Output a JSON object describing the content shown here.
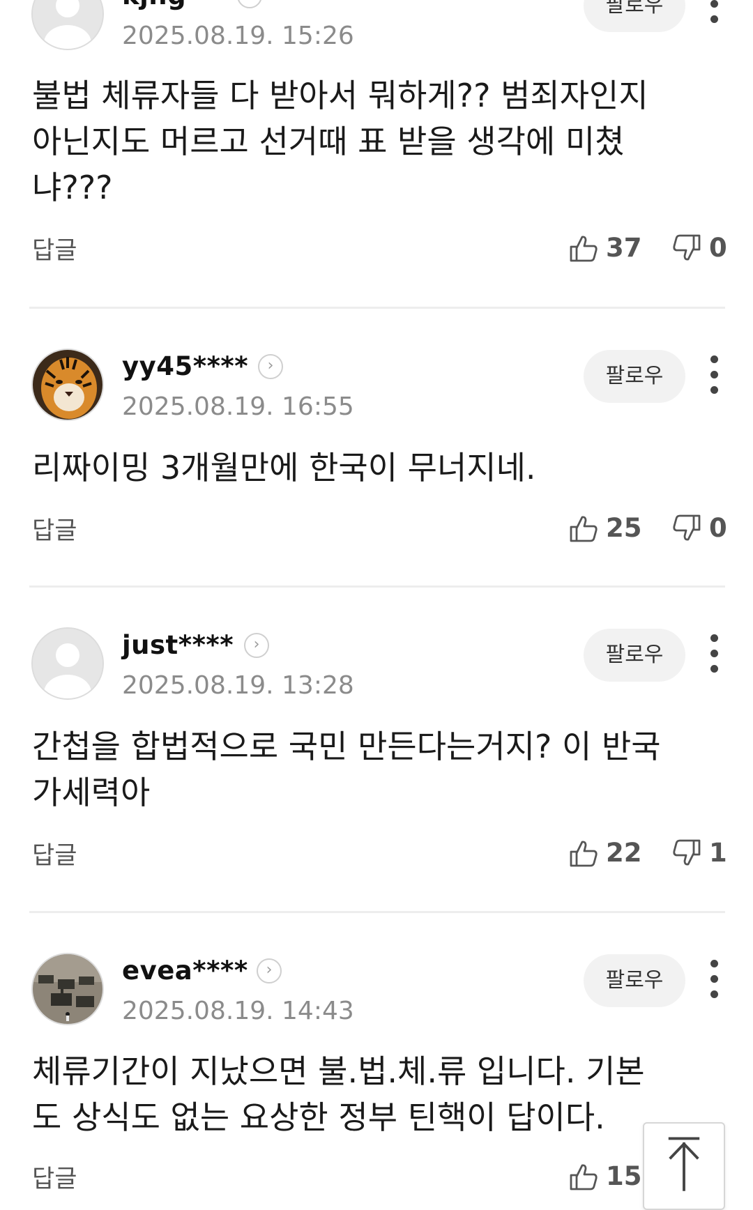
{
  "comments": [
    {
      "username": "kjng",
      "timestamp": "2025.08.19. 15:26",
      "follow_label": "팔로우",
      "body": "불법 체류자들 다 받아서 뭐하게?? 범죄자인지\n아닌지도 머르고 선거때 표 받을 생각에 미쳤\n냐???",
      "reply_label": "답글",
      "likes": "37",
      "dislikes": "0",
      "avatar": "default-avatar"
    },
    {
      "username": "yy45****",
      "timestamp": "2025.08.19. 16:55",
      "follow_label": "팔로우",
      "body": "리짜이밍 3개월만에 한국이 무너지네.",
      "reply_label": "답글",
      "likes": "25",
      "dislikes": "0",
      "avatar": "tiger-photo"
    },
    {
      "username": "just****",
      "timestamp": "2025.08.19. 13:28",
      "follow_label": "팔로우",
      "body": "간첩을 합법적으로 국민 만든다는거지? 이 반국\n가세력아",
      "reply_label": "답글",
      "likes": "22",
      "dislikes": "1",
      "avatar": "default-avatar"
    },
    {
      "username": "evea****",
      "timestamp": "2025.08.19. 14:43",
      "follow_label": "팔로우",
      "body": "체류기간이 지났으면 불.법.체.류 입니다. 기본\n도 상식도 없는 요상한 정부 틴핵이 답이다.",
      "reply_label": "답글",
      "likes": "15",
      "avatar": "tanks-photo"
    }
  ],
  "icons": {
    "like": "thumbs-up-icon",
    "dislike": "thumbs-down-icon",
    "more": "vertical-ellipsis-icon",
    "chevron": "chevron-right-icon",
    "scroll_top": "arrow-up-icon"
  },
  "colors": {
    "meta_gray": "#8b8b8b",
    "follow_bg": "#f2f2f2",
    "divider": "#ededed"
  }
}
